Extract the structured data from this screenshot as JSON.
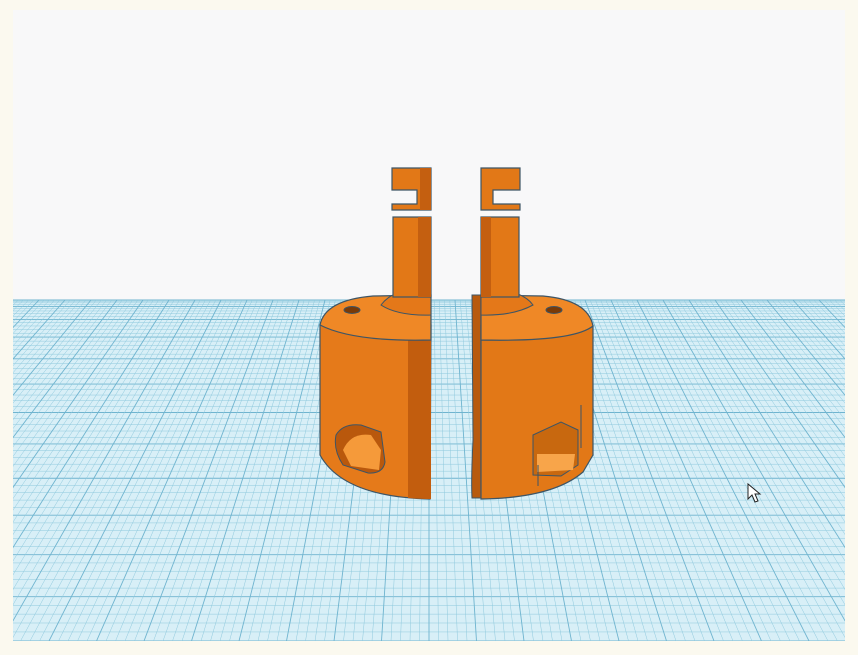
{
  "app": {
    "name": ""
  },
  "viewport": {
    "background_color": "#f8f8f9",
    "workplane_color": "#d6eef7",
    "grid_line_color": "#8fc9dd",
    "grid_major_color": "#6fb4cf"
  },
  "scene": {
    "objects": [
      {
        "label": "",
        "kind": "half-cylinder-part-left",
        "color": "#e07518"
      },
      {
        "label": "",
        "kind": "half-cylinder-part-right",
        "color": "#e07518"
      }
    ]
  },
  "cursor": {
    "icon": "arrow-cursor-icon"
  }
}
